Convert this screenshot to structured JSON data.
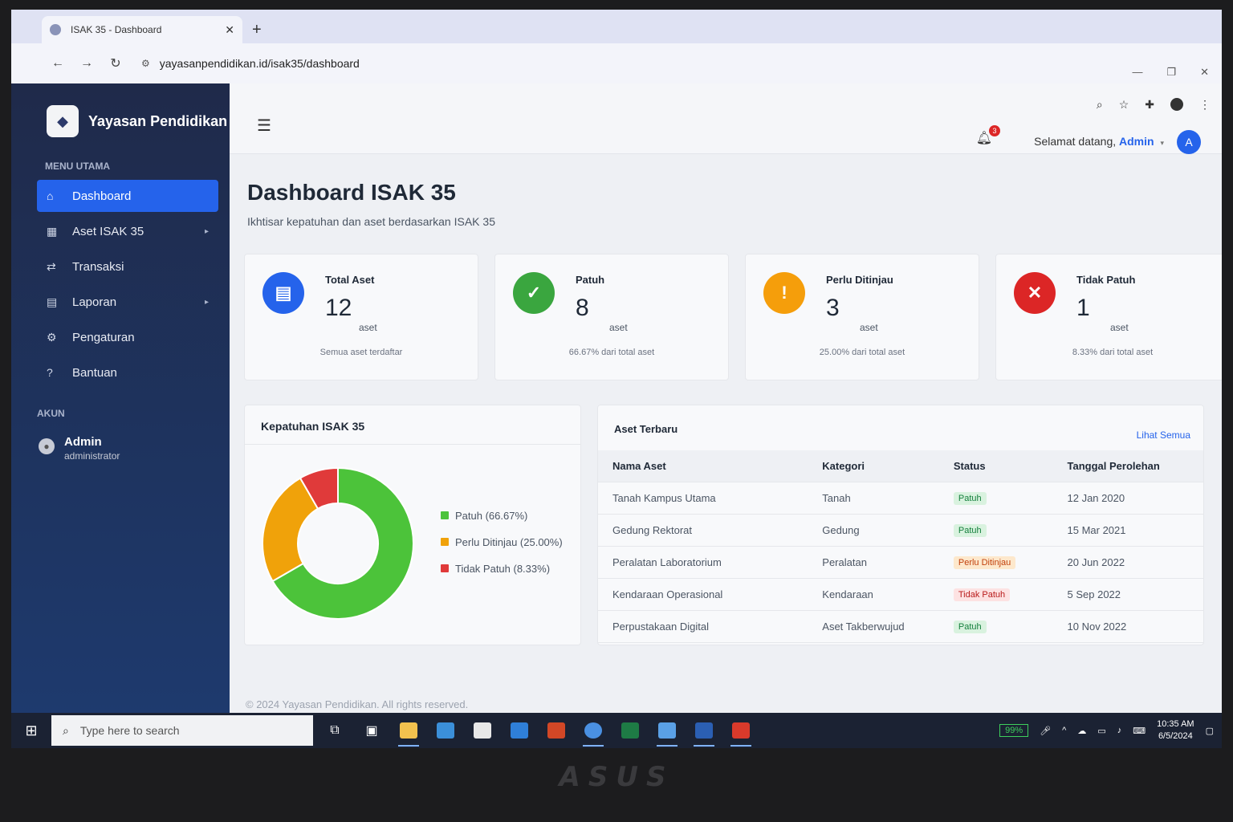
{
  "browser": {
    "tab_title": "ISAK 35 - Dashboard",
    "url": "yayasanpendidikan.id/isak35/dashboard"
  },
  "sidebar": {
    "brand": "Yayasan Pendidikan",
    "menu_heading": "MENU UTAMA",
    "items": [
      {
        "label": "Dashboard",
        "icon": "home-icon",
        "active": true
      },
      {
        "label": "Aset ISAK 35",
        "icon": "building-icon",
        "has_submenu": true
      },
      {
        "label": "Transaksi",
        "icon": "exchange-icon"
      },
      {
        "label": "Laporan",
        "icon": "report-icon",
        "has_submenu": true
      },
      {
        "label": "Pengaturan",
        "icon": "gear-icon"
      },
      {
        "label": "Bantuan",
        "icon": "help-icon"
      }
    ],
    "account_heading": "AKUN",
    "account": {
      "name": "Admin",
      "role": "administrator"
    }
  },
  "topbar": {
    "notification_count": "3",
    "welcome_text": "Selamat datang,",
    "user_name": "Admin",
    "avatar_initial": "A"
  },
  "page": {
    "title": "Dashboard ISAK 35",
    "subtitle": "Ikhtisar kepatuhan dan aset berdasarkan ISAK 35"
  },
  "cards": [
    {
      "title": "Total Aset",
      "value": "12",
      "unit": "aset",
      "note": "Semua aset terdaftar",
      "color": "#2563eb",
      "icon": "document-icon"
    },
    {
      "title": "Patuh",
      "value": "8",
      "unit": "aset",
      "note": "66.67% dari total aset",
      "color": "#3aa63f",
      "icon": "check-icon"
    },
    {
      "title": "Perlu Ditinjau",
      "value": "3",
      "unit": "aset",
      "note": "25.00% dari total aset",
      "color": "#f59e0b",
      "icon": "warning-icon"
    },
    {
      "title": "Tidak Patuh",
      "value": "1",
      "unit": "aset",
      "note": "8.33% dari total aset",
      "color": "#dc2626",
      "icon": "x-icon"
    }
  ],
  "compliance": {
    "title": "Kepatuhan ISAK 35",
    "legend": [
      {
        "label": "Patuh (66.67%)",
        "color": "#4cc33a"
      },
      {
        "label": "Perlu Ditinjau (25.00%)",
        "color": "#f0a20a"
      },
      {
        "label": "Tidak Patuh (8.33%)",
        "color": "#e03a3a"
      }
    ]
  },
  "chart_data": {
    "type": "pie",
    "categories": [
      "Patuh",
      "Perlu Ditinjau",
      "Tidak Patuh"
    ],
    "values": [
      66.67,
      25.0,
      8.33
    ],
    "colors": [
      "#4cc33a",
      "#f0a20a",
      "#e03a3a"
    ],
    "title": "Kepatuhan ISAK 35",
    "legend_position": "right"
  },
  "recent_assets": {
    "title": "Aset Terbaru",
    "view_all": "Lihat Semua",
    "columns": [
      "Nama Aset",
      "Kategori",
      "Status",
      "Tanggal Perolehan"
    ],
    "rows": [
      {
        "name": "Tanah Kampus Utama",
        "category": "Tanah",
        "status": "Patuh",
        "status_type": "patuh",
        "date": "12 Jan 2020"
      },
      {
        "name": "Gedung Rektorat",
        "category": "Gedung",
        "status": "Patuh",
        "status_type": "patuh",
        "date": "15 Mar 2021"
      },
      {
        "name": "Peralatan Laboratorium",
        "category": "Peralatan",
        "status": "Perlu Ditinjau",
        "status_type": "ditinjau",
        "date": "20 Jun 2022"
      },
      {
        "name": "Kendaraan Operasional",
        "category": "Kendaraan",
        "status": "Tidak Patuh",
        "status_type": "tidak",
        "date": "5 Sep 2022"
      },
      {
        "name": "Perpustakaan Digital",
        "category": "Aset Takberwujud",
        "status": "Patuh",
        "status_type": "patuh",
        "date": "10 Nov 2022"
      }
    ]
  },
  "footer": "© 2024 Yayasan Pendidikan. All rights reserved.",
  "taskbar": {
    "search_placeholder": "Type here to search",
    "battery": "99%",
    "time": "10:35 AM",
    "date": "6/5/2024"
  },
  "device_brand": "ASUS"
}
